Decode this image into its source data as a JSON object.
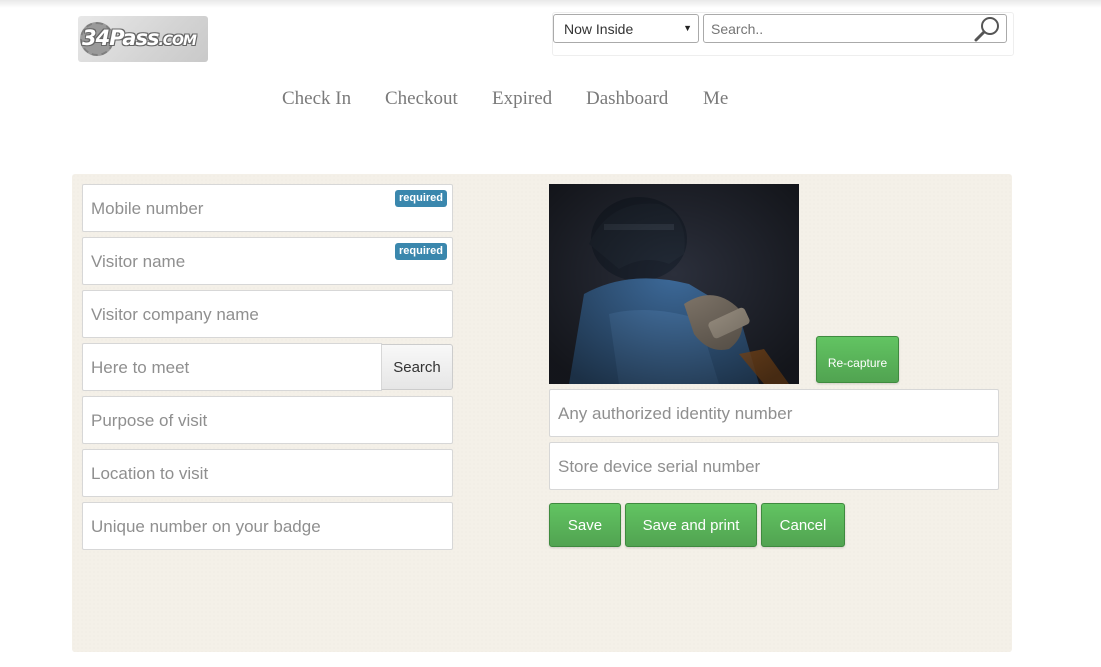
{
  "logo": {
    "text_main": "34Pass",
    "text_suffix": ".COM"
  },
  "header": {
    "filter_select": {
      "selected": "Now Inside"
    },
    "search": {
      "placeholder": "Search.."
    }
  },
  "nav": {
    "items": [
      {
        "label": "Check In"
      },
      {
        "label": "Checkout"
      },
      {
        "label": "Expired"
      },
      {
        "label": "Dashboard"
      },
      {
        "label": "Me"
      }
    ]
  },
  "form": {
    "required_badge": "required",
    "mobile_placeholder": "Mobile number",
    "visitor_name_placeholder": "Visitor name",
    "company_placeholder": "Visitor company name",
    "meet_placeholder": "Here to meet",
    "meet_search_label": "Search",
    "purpose_placeholder": "Purpose of visit",
    "location_placeholder": "Location to visit",
    "badge_placeholder": "Unique number on your badge",
    "identity_placeholder": "Any authorized identity number",
    "device_placeholder": "Store device serial number",
    "recapture_label": "Re-capture",
    "save_label": "Save",
    "save_print_label": "Save and print",
    "cancel_label": "Cancel"
  },
  "colors": {
    "accent_green": "#5bb75b",
    "required_blue": "#3a87ad",
    "panel_bg": "#f4f0e8"
  },
  "icons": {
    "search": "magnifier-icon",
    "dropdown": "chevron-down-icon"
  }
}
